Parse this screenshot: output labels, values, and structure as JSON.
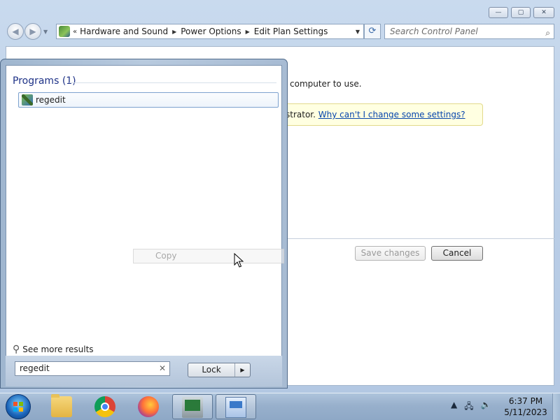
{
  "window": {
    "caption_buttons": {
      "minimize": "—",
      "maximize": "▢",
      "close": "✕"
    },
    "address": {
      "chevrons": "«",
      "crumbs": [
        "Hardware and Sound",
        "Power Options",
        "Edit Plan Settings"
      ]
    },
    "search_placeholder": "Search Control Panel",
    "content": {
      "description_fragment": "computer to use.",
      "info_prefix": "strator.",
      "info_link": "Why can't I change some settings?",
      "save_button": "Save changes",
      "cancel_button": "Cancel"
    }
  },
  "start_menu": {
    "programs_title": "Programs (1)",
    "result_item": "regedit",
    "see_more": "See more results",
    "search_value": "regedit",
    "lock_button": "Lock"
  },
  "ghost_menu": {
    "label": "Copy"
  },
  "taskbar": {
    "apps": [
      "windows-explorer",
      "google-chrome",
      "firefox",
      "task-manager",
      "control-panel"
    ],
    "clock_time": "6:37 PM",
    "clock_date": "5/11/2023"
  },
  "colors": {
    "link": "#0645ad",
    "info_bar": "#ffffe1",
    "programs_title": "#1e3287"
  }
}
